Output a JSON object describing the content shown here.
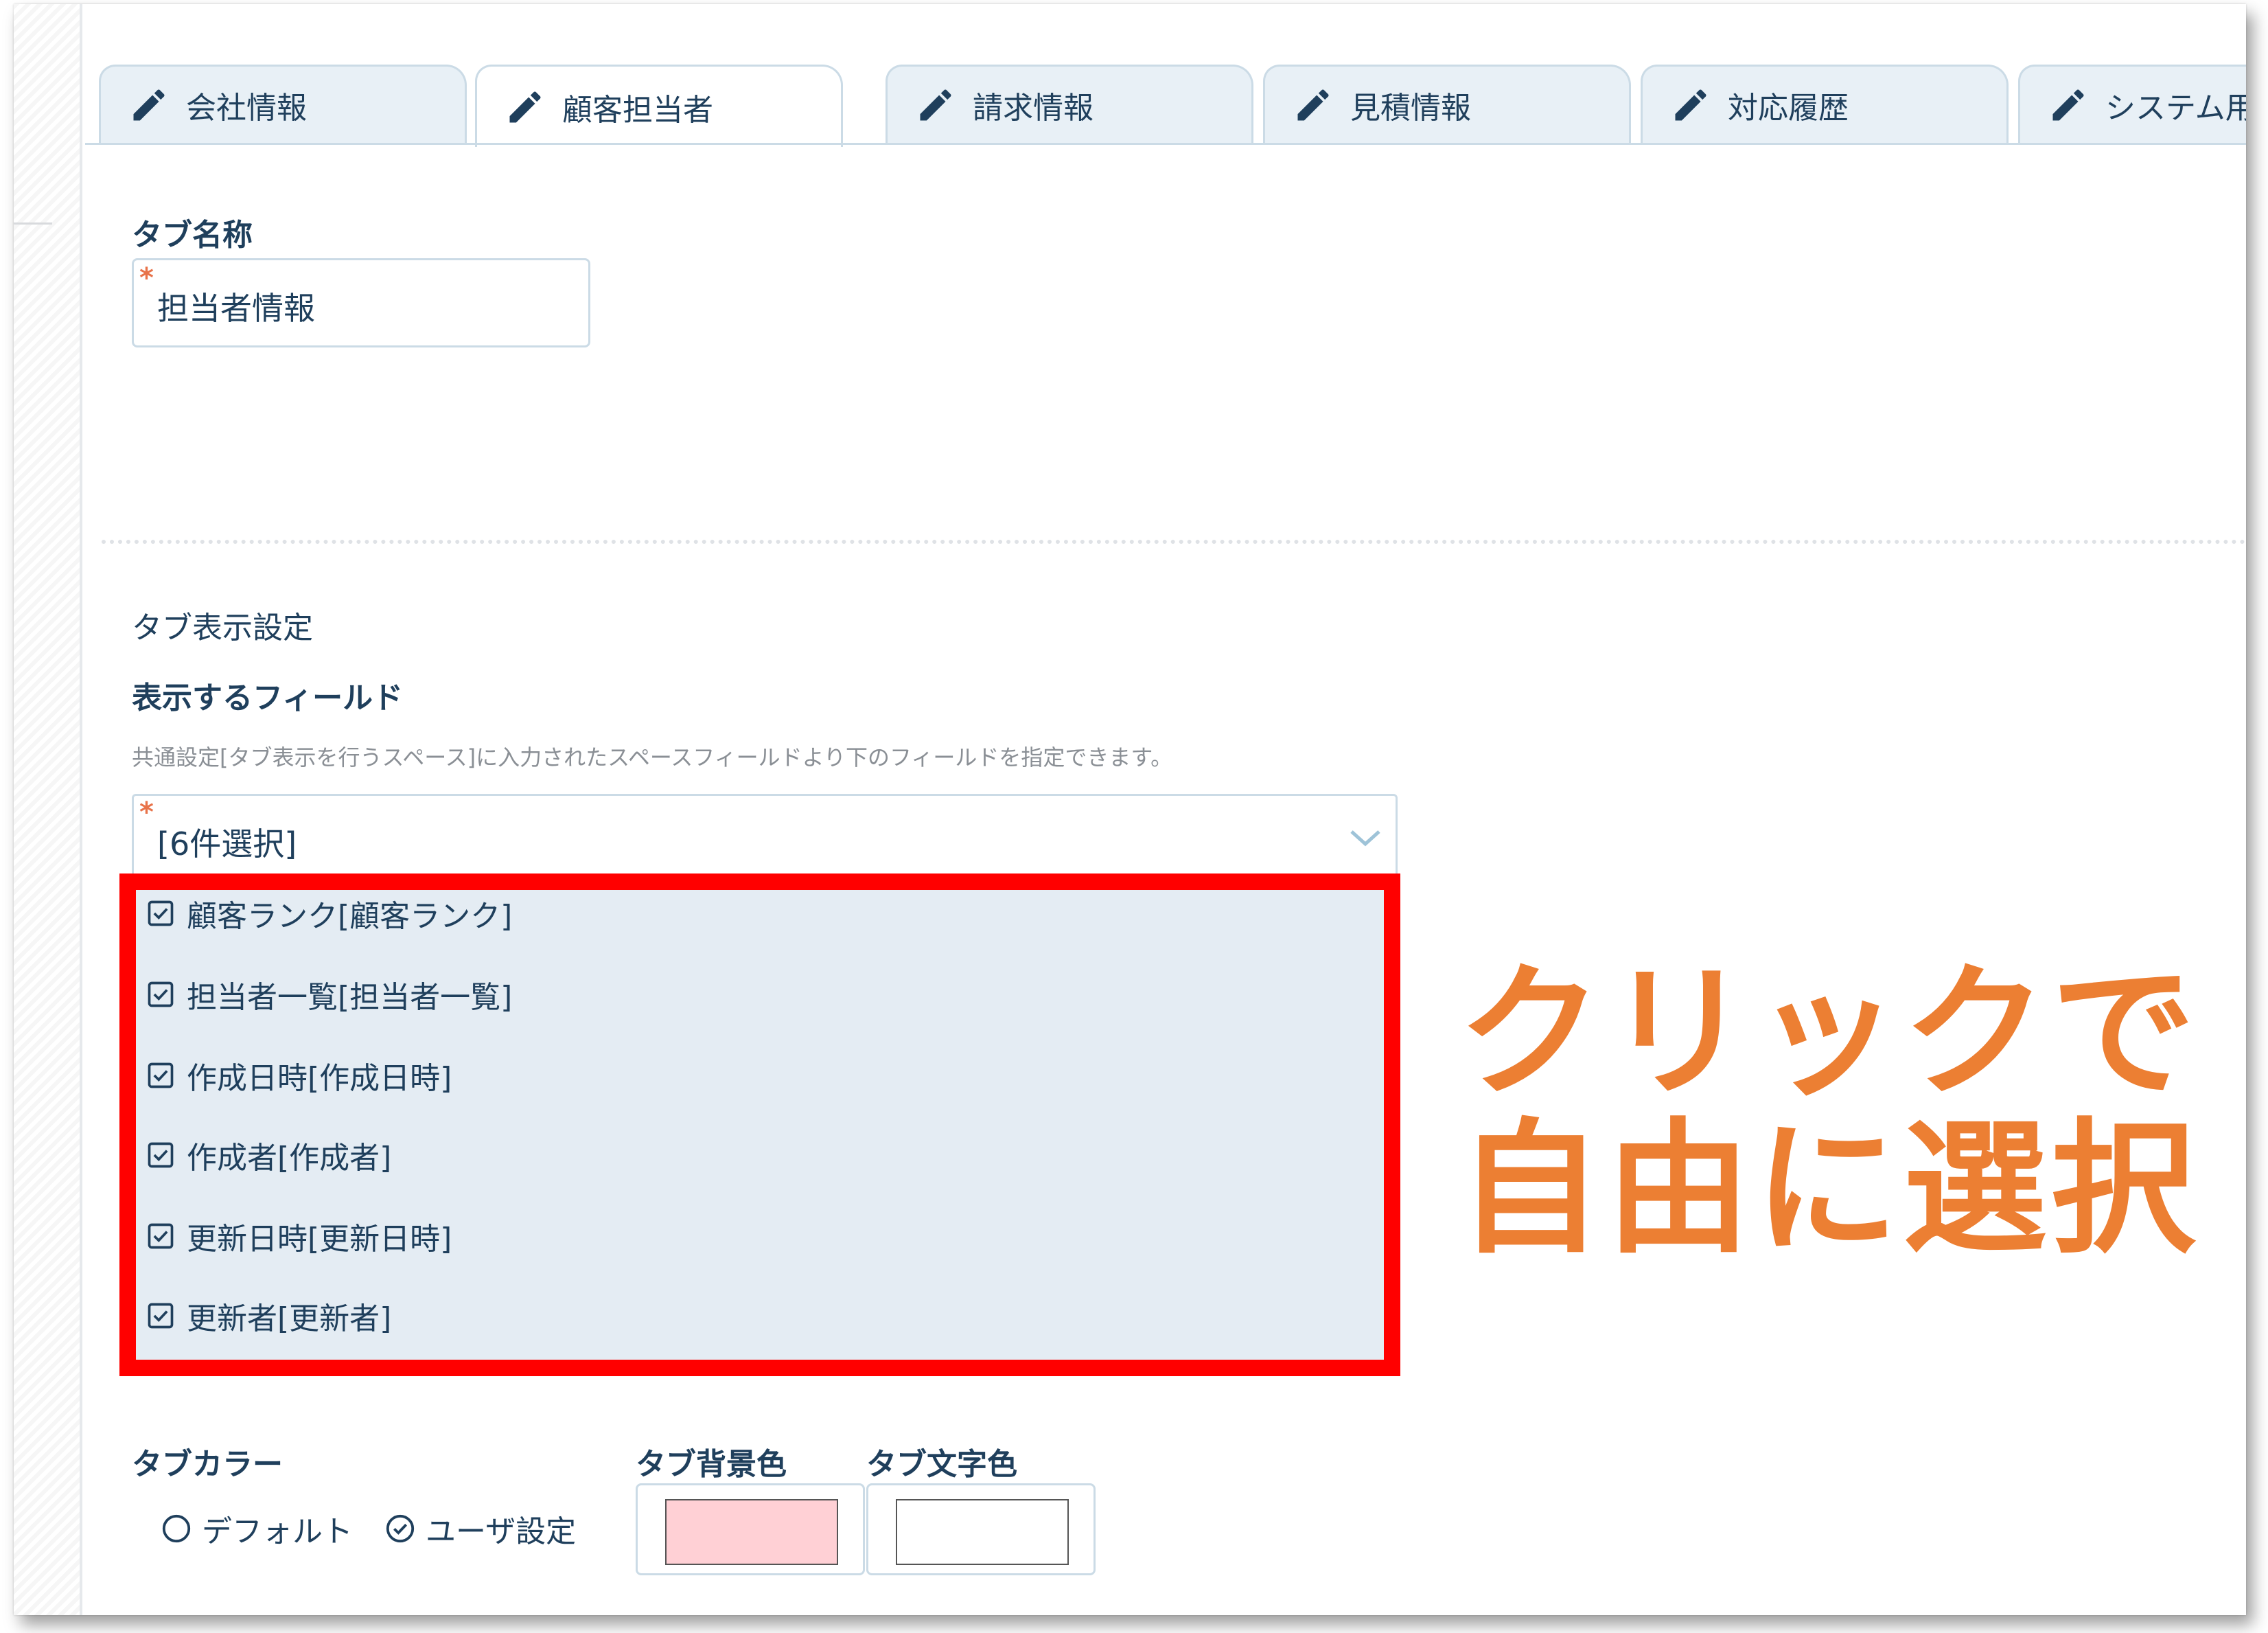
{
  "colors": {
    "accent_text": "#1f3f5c",
    "required_mark": "#e8734a",
    "highlight_border": "#ff0000",
    "callout_text": "#ec7f33",
    "tab_background_swatch": "#ffd0d5",
    "tab_text_swatch": "#ffffff"
  },
  "tabs": [
    {
      "label": "会社情報",
      "icon": "pencil-icon",
      "active": false
    },
    {
      "label": "顧客担当者",
      "icon": "pencil-icon",
      "active": true
    },
    {
      "label": "請求情報",
      "icon": "pencil-icon",
      "active": false
    },
    {
      "label": "見積情報",
      "icon": "pencil-icon",
      "active": false
    },
    {
      "label": "対応履歴",
      "icon": "pencil-icon",
      "active": false
    },
    {
      "label": "システム用",
      "icon": "pencil-icon",
      "active": false
    }
  ],
  "tab_name": {
    "label": "タブ名称",
    "required_mark": "*",
    "value": "担当者情報"
  },
  "display_settings": {
    "section_title": "タブ表示設定",
    "fields_label": "表示するフィールド",
    "help_text": "共通設定[タブ表示を行うスペース]に入力されたスペースフィールドより下のフィールドを指定できます。",
    "required_mark": "*",
    "selected_summary": "[6件選択]",
    "options": [
      {
        "label": "顧客ランク[顧客ランク]",
        "checked": true
      },
      {
        "label": "担当者一覧[担当者一覧]",
        "checked": true
      },
      {
        "label": "作成日時[作成日時]",
        "checked": true
      },
      {
        "label": "作成者[作成者]",
        "checked": true
      },
      {
        "label": "更新日時[更新日時]",
        "checked": true
      },
      {
        "label": "更新者[更新者]",
        "checked": true
      }
    ]
  },
  "callout": {
    "line1": "クリックで",
    "line2": "自由に選択"
  },
  "tab_color": {
    "label": "タブカラー",
    "options": [
      {
        "label": "デフォルト",
        "selected": false
      },
      {
        "label": "ユーザ設定",
        "selected": true
      }
    ],
    "background_label": "タブ背景色",
    "text_label": "タブ文字色"
  }
}
